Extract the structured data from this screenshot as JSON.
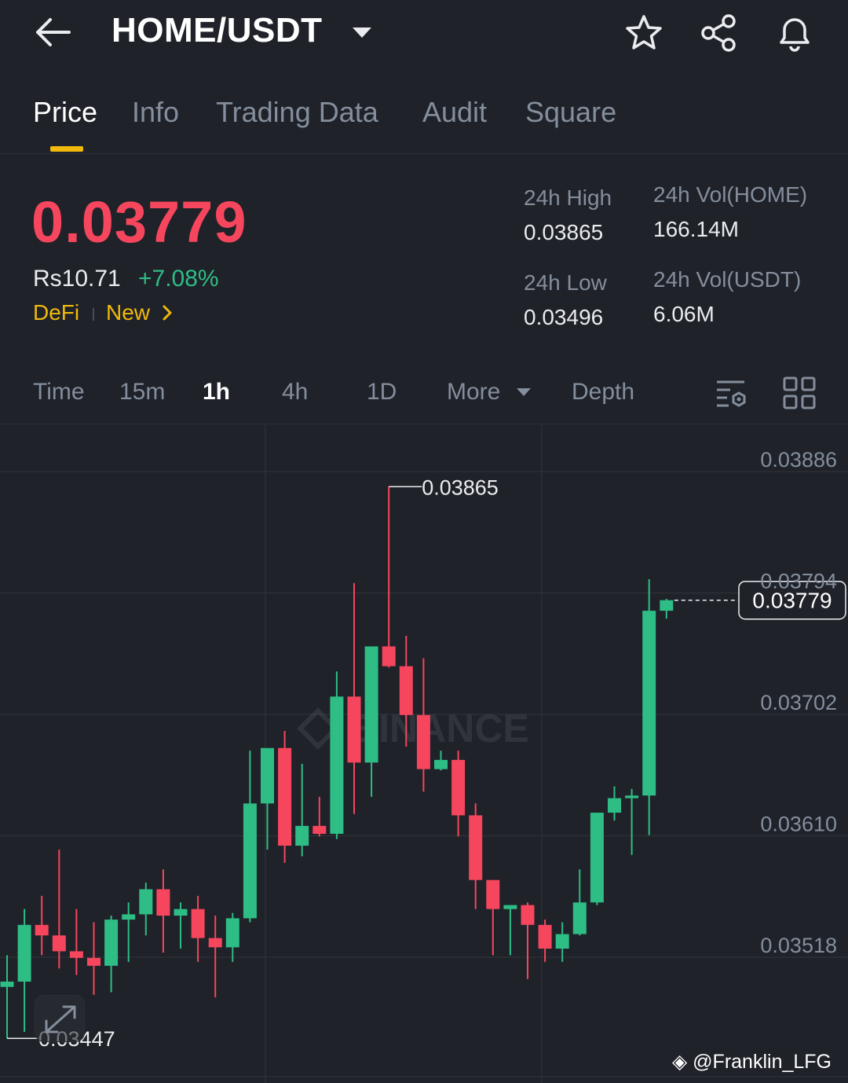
{
  "header": {
    "pair": "HOME/USDT",
    "icons": [
      "back-arrow-icon",
      "chevron-down-icon",
      "star-icon",
      "share-icon",
      "bell-icon"
    ]
  },
  "tabs": [
    {
      "label": "Price",
      "active": true
    },
    {
      "label": "Info",
      "active": false
    },
    {
      "label": "Trading Data",
      "active": false
    },
    {
      "label": "Audit",
      "active": false
    },
    {
      "label": "Square",
      "active": false
    }
  ],
  "ticker": {
    "last_price": "0.03779",
    "fiat_price": "Rs10.71",
    "change_pct": "+7.08%",
    "tags": [
      "DeFi",
      "New"
    ],
    "high_label": "24h High",
    "high_value": "0.03865",
    "low_label": "24h Low",
    "low_value": "0.03496",
    "vol_base_label": "24h Vol(HOME)",
    "vol_base_value": "166.14M",
    "vol_quote_label": "24h Vol(USDT)",
    "vol_quote_value": "6.06M"
  },
  "intervals": {
    "items": [
      "Time",
      "15m",
      "1h",
      "4h",
      "1D",
      "More",
      "Depth"
    ],
    "active": "1h",
    "icons": [
      "chart-settings-icon",
      "grid-layout-icon"
    ]
  },
  "colors": {
    "up": "#2ebd85",
    "down": "#f6465d",
    "accent": "#f0b90b",
    "background": "#1f2229"
  },
  "chart_data": {
    "type": "candlestick",
    "y_ticks": [
      "0.03886",
      "0.03794",
      "0.03702",
      "0.03610",
      "0.03518"
    ],
    "ylim": [
      0.0342,
      0.03915
    ],
    "current_price_label": "0.03779",
    "max_label": "0.03865",
    "min_label": "0.03447",
    "watermark": "BINANCE",
    "candles": [
      {
        "o": 0.03486,
        "h": 0.0351,
        "l": 0.03447,
        "c": 0.0349
      },
      {
        "o": 0.0349,
        "h": 0.03545,
        "l": 0.03452,
        "c": 0.03533
      },
      {
        "o": 0.03533,
        "h": 0.03555,
        "l": 0.0351,
        "c": 0.03525
      },
      {
        "o": 0.03525,
        "h": 0.0359,
        "l": 0.035,
        "c": 0.03513
      },
      {
        "o": 0.03513,
        "h": 0.03545,
        "l": 0.03495,
        "c": 0.03508
      },
      {
        "o": 0.03508,
        "h": 0.03535,
        "l": 0.0348,
        "c": 0.03502
      },
      {
        "o": 0.03502,
        "h": 0.0354,
        "l": 0.03482,
        "c": 0.03537
      },
      {
        "o": 0.03537,
        "h": 0.0355,
        "l": 0.03505,
        "c": 0.03541
      },
      {
        "o": 0.03541,
        "h": 0.03565,
        "l": 0.03525,
        "c": 0.0356
      },
      {
        "o": 0.0356,
        "h": 0.03575,
        "l": 0.03512,
        "c": 0.0354
      },
      {
        "o": 0.0354,
        "h": 0.0355,
        "l": 0.03515,
        "c": 0.03545
      },
      {
        "o": 0.03545,
        "h": 0.03555,
        "l": 0.03505,
        "c": 0.03523
      },
      {
        "o": 0.03523,
        "h": 0.0354,
        "l": 0.03478,
        "c": 0.03516
      },
      {
        "o": 0.03516,
        "h": 0.03542,
        "l": 0.03505,
        "c": 0.03538
      },
      {
        "o": 0.03538,
        "h": 0.03665,
        "l": 0.03535,
        "c": 0.03625
      },
      {
        "o": 0.03625,
        "h": 0.0366,
        "l": 0.0359,
        "c": 0.03667
      },
      {
        "o": 0.03667,
        "h": 0.0368,
        "l": 0.0358,
        "c": 0.03593
      },
      {
        "o": 0.03593,
        "h": 0.03655,
        "l": 0.03585,
        "c": 0.03608
      },
      {
        "o": 0.03608,
        "h": 0.0363,
        "l": 0.036,
        "c": 0.03602
      },
      {
        "o": 0.03602,
        "h": 0.03725,
        "l": 0.03598,
        "c": 0.03706
      },
      {
        "o": 0.03706,
        "h": 0.03792,
        "l": 0.03617,
        "c": 0.03656
      },
      {
        "o": 0.03656,
        "h": 0.03725,
        "l": 0.0363,
        "c": 0.03744
      },
      {
        "o": 0.03744,
        "h": 0.03865,
        "l": 0.03728,
        "c": 0.03729
      },
      {
        "o": 0.03729,
        "h": 0.03752,
        "l": 0.03668,
        "c": 0.03692
      },
      {
        "o": 0.03692,
        "h": 0.03735,
        "l": 0.03634,
        "c": 0.03651
      },
      {
        "o": 0.03651,
        "h": 0.03665,
        "l": 0.0365,
        "c": 0.03658
      },
      {
        "o": 0.03658,
        "h": 0.03665,
        "l": 0.036,
        "c": 0.03616
      },
      {
        "o": 0.03616,
        "h": 0.03625,
        "l": 0.03545,
        "c": 0.03567
      },
      {
        "o": 0.03567,
        "h": 0.03565,
        "l": 0.0351,
        "c": 0.03545
      },
      {
        "o": 0.03545,
        "h": 0.03547,
        "l": 0.0351,
        "c": 0.03548
      },
      {
        "o": 0.03548,
        "h": 0.0355,
        "l": 0.03492,
        "c": 0.03533
      },
      {
        "o": 0.03533,
        "h": 0.03537,
        "l": 0.03505,
        "c": 0.03515
      },
      {
        "o": 0.03515,
        "h": 0.03535,
        "l": 0.03505,
        "c": 0.03526
      },
      {
        "o": 0.03526,
        "h": 0.03575,
        "l": 0.03525,
        "c": 0.0355
      },
      {
        "o": 0.0355,
        "h": 0.03618,
        "l": 0.03548,
        "c": 0.03618
      },
      {
        "o": 0.03618,
        "h": 0.03638,
        "l": 0.03612,
        "c": 0.03629
      },
      {
        "o": 0.03629,
        "h": 0.03636,
        "l": 0.03586,
        "c": 0.03631
      },
      {
        "o": 0.03631,
        "h": 0.03795,
        "l": 0.03601,
        "c": 0.03771
      },
      {
        "o": 0.03771,
        "h": 0.0378,
        "l": 0.03765,
        "c": 0.03779
      }
    ]
  }
}
